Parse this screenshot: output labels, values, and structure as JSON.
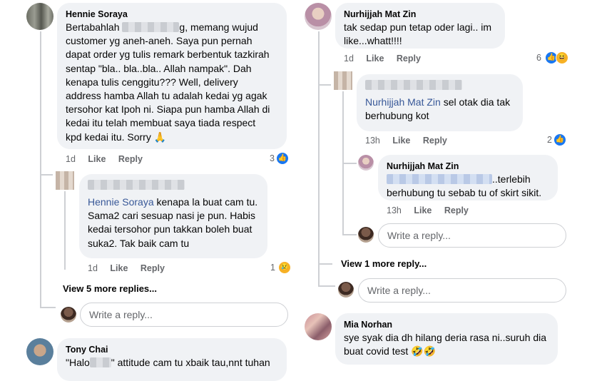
{
  "left": {
    "c1": {
      "name": "Hennie Soraya",
      "text_a": "Bertabahlah ",
      "text_b": "g, memang wujud\ncustomer yg aneh-aneh. Saya pun pernah\ndapat order yg tulis remark berbentuk tazkirah\nsentap \"bla.. bla..bla.. Allah nampak\". Dah\nkenapa tulis cenggitu??? Well, delivery\naddress hamba Allah tu adalah kedai yg agak\ntersohor kat Ipoh ni. Siapa pun hamba Allah di\nkedai itu telah membuat saya tiada respect\nkpd kedai itu. Sorry 🙏",
      "time": "1d",
      "like": "Like",
      "reply": "Reply",
      "count": "3"
    },
    "r1": {
      "mention": "Hennie Soraya",
      "text": " kenapa la buat cam tu.\nSama2 cari sesuap nasi je pun. Habis\nkedai tersohor pun takkan boleh buat\nsuka2. Tak baik cam tu",
      "time": "1d",
      "like": "Like",
      "reply": "Reply",
      "count": "1"
    },
    "view_more": "View 5 more replies...",
    "write_placeholder": "Write a reply...",
    "c2": {
      "name": "Tony Chai",
      "text_a": "\"Halo",
      "text_b": "\" attitude cam tu xbaik tau,nnt tuhan"
    }
  },
  "right": {
    "c1": {
      "name": "Nurhijjah Mat Zin",
      "text": "tak sedap pun tetap oder lagi.. im\nlike...whatt!!!!",
      "time": "1d",
      "like": "Like",
      "reply": "Reply",
      "count": "6"
    },
    "r1": {
      "mention": "Nurhijjah Mat Zin",
      "text_a": " sel otak dia tak",
      "text_b": "berhubung kot",
      "time": "13h",
      "like": "Like",
      "reply": "Reply",
      "count": "2"
    },
    "r2": {
      "name": "Nurhijjah Mat Zin",
      "text_a": "..terlebih",
      "text_b": "berhubung tu sebab tu of skirt sikit.",
      "time": "13h",
      "like": "Like",
      "reply": "Reply"
    },
    "write_placeholder_1": "Write a reply...",
    "view_more": "View 1 more reply...",
    "write_placeholder_2": "Write a reply...",
    "c2": {
      "name": "Mia Norhan",
      "text": "sye syak dia dh hilang deria rasa ni..suruh dia\nbuat covid test 🤣🤣"
    }
  },
  "colors": {
    "link": "#385898",
    "meta": "#65676b",
    "bubble": "#f0f2f5",
    "like": "#1877f2"
  },
  "icons": [
    "like-reaction-icon",
    "haha-reaction-icon",
    "sad-reaction-icon"
  ]
}
